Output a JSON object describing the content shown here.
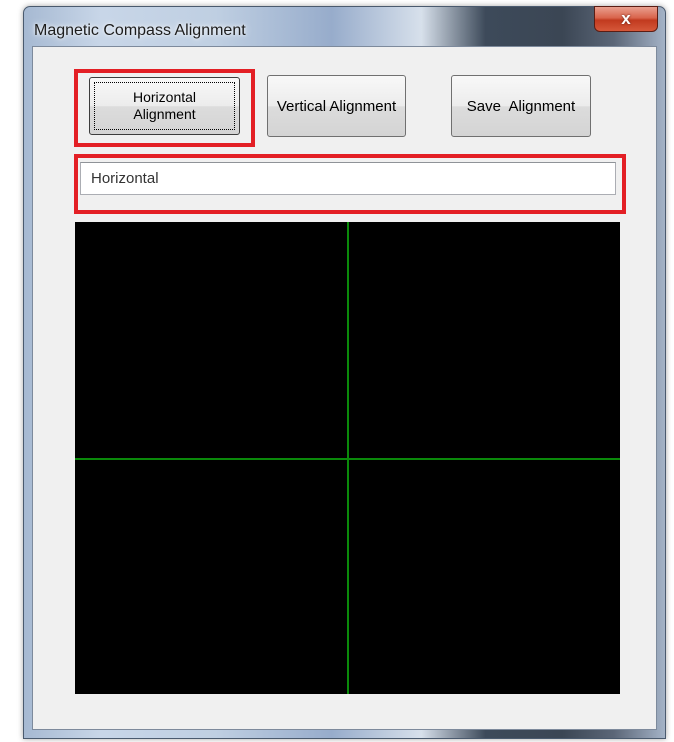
{
  "window": {
    "title": "Magnetic Compass Alignment",
    "close_glyph": "x"
  },
  "toolbar": {
    "horizontal_line1": "Horizontal",
    "horizontal_line2": "Alignment",
    "vertical_label": "Vertical Alignment",
    "save_label": "Save  Alignment"
  },
  "mode_field": {
    "value": "Horizontal"
  },
  "display": {
    "background_color": "#000000",
    "crosshair_color": "#0a8a0a",
    "crosshair": true
  },
  "highlight_color": "#e31f25"
}
